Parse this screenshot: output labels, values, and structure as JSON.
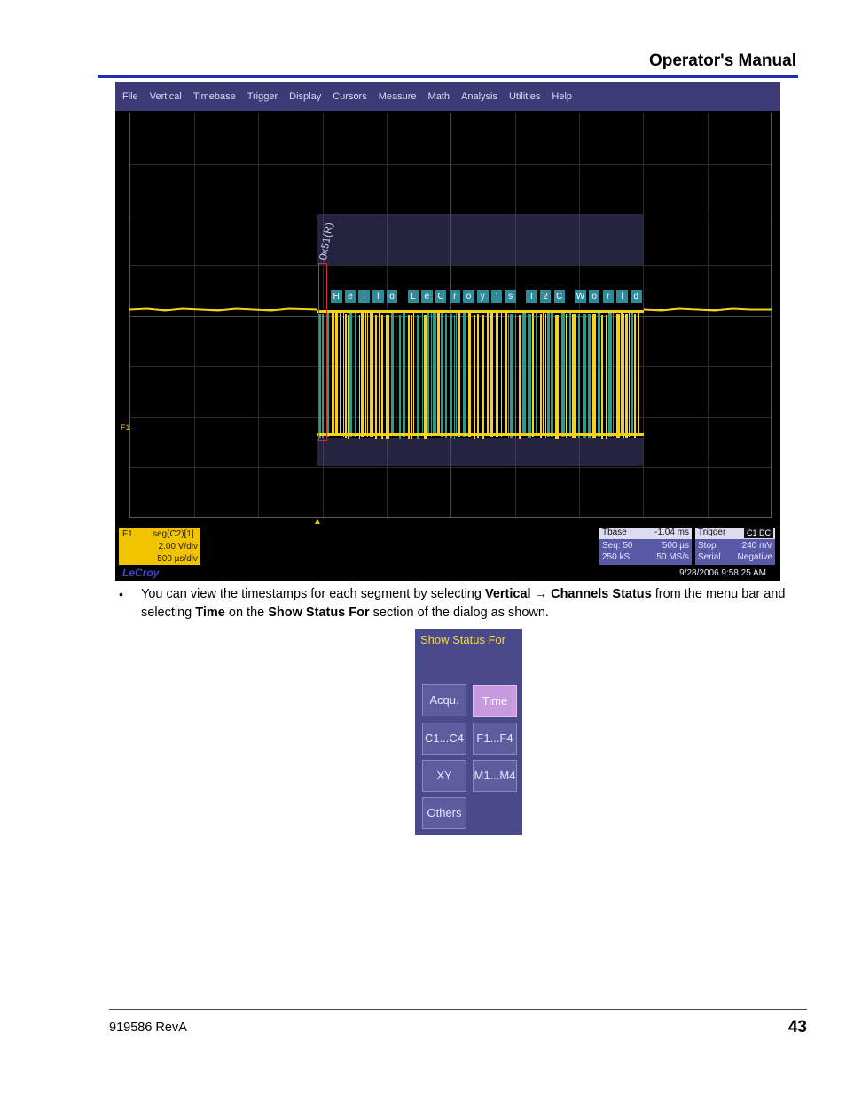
{
  "header": {
    "title": "Operator's Manual"
  },
  "scope": {
    "menu": [
      "File",
      "Vertical",
      "Timebase",
      "Trigger",
      "Display",
      "Cursors",
      "Measure",
      "Math",
      "Analysis",
      "Utilities",
      "Help"
    ],
    "address_label": "0x51(R)",
    "decoded_chars": [
      "H",
      "e",
      "l",
      "l",
      "o",
      "L",
      "e",
      "C",
      "r",
      "o",
      "y",
      "'",
      "s",
      "I",
      "2",
      "C",
      "W",
      "o",
      "r",
      "l",
      "d"
    ],
    "channel_marker": "F1",
    "f1_box": {
      "label": "F1",
      "source": "seg(C2)[1]",
      "vdiv": "2.00 V/div",
      "tdiv": "500 µs/div"
    },
    "logo": "LeCroy",
    "timebase": {
      "header_left": "Tbase",
      "header_right": "-1.04 ms",
      "r1_left": "Seq: 50",
      "r1_right": "500 µs",
      "r2_left": "250 kS",
      "r2_right": "50 MS/s"
    },
    "trigger": {
      "header_left": "Trigger",
      "badge": "C1 DC",
      "r1_left": "Stop",
      "r1_right": "240 mV",
      "r2_left": "Serial",
      "r2_right": "Negative"
    },
    "timestamp": "9/28/2006 9:58:25 AM"
  },
  "body": {
    "bullet": "•",
    "t1": "You can view the timestamps for each segment by selecting ",
    "b1": "Vertical → Channels Status",
    "t2": " from the menu bar and selecting ",
    "b2": "Time",
    "t3": " on the ",
    "b3": "Show Status For",
    "t4": " section of the dialog as shown."
  },
  "dialog": {
    "title": "Show Status For",
    "buttons": {
      "acqu": "Acqu.",
      "time": "Time",
      "c1c4": "C1...C4",
      "f1f4": "F1...F4",
      "xy": "XY",
      "m1m4": "M1...M4",
      "others": "Others"
    },
    "selected": "Time"
  },
  "footer": {
    "doc_id": "919586 RevA",
    "page_number": "43"
  },
  "colors": {
    "rule": "#1f2fb4",
    "trace": "#f2d21a",
    "trace_alt": "#2f9a8a",
    "dialog_bg": "#4a4a8a",
    "selected_button": "#c79ae0"
  }
}
